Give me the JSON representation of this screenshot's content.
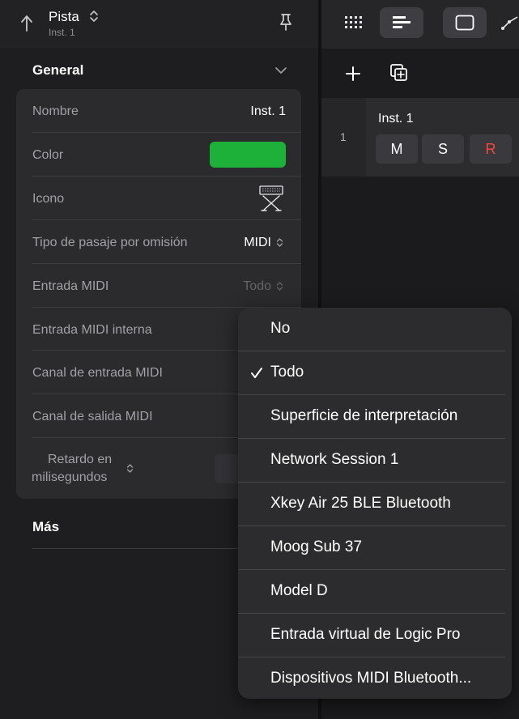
{
  "inspector": {
    "header": {
      "title": "Pista",
      "subtitle": "Inst. 1"
    },
    "general": {
      "title": "General",
      "rows": [
        {
          "label": "Nombre",
          "value": "Inst. 1"
        },
        {
          "label": "Color",
          "value": "",
          "color": "#1eb13a"
        },
        {
          "label": "Icono",
          "icon": "keyboard-stand-icon"
        },
        {
          "label": "Tipo de pasaje por omisión",
          "value": "MIDI"
        },
        {
          "label": "Entrada MIDI",
          "value": "Todo"
        },
        {
          "label": "Entrada MIDI interna"
        },
        {
          "label": "Canal de entrada MIDI"
        },
        {
          "label": "Canal de salida MIDI"
        },
        {
          "label_line1": "Retardo en",
          "label_line2": "milisegundos"
        }
      ]
    },
    "more": {
      "title": "Más"
    }
  },
  "tracks": {
    "rows": [
      {
        "number": "1",
        "name": "Inst. 1",
        "mute": "M",
        "solo": "S",
        "record": "R"
      }
    ]
  },
  "menu": {
    "items": [
      {
        "label": "No",
        "checked": false
      },
      {
        "label": "Todo",
        "checked": true
      },
      {
        "label": "Superficie de interpretación",
        "checked": false
      },
      {
        "label": "Network Session 1",
        "checked": false
      },
      {
        "label": "Xkey Air 25 BLE Bluetooth",
        "checked": false
      },
      {
        "label": "Moog Sub 37",
        "checked": false
      },
      {
        "label": "Model D",
        "checked": false
      },
      {
        "label": "Entrada virtual de Logic Pro",
        "checked": false
      },
      {
        "label": "Dispositivos MIDI Bluetooth...",
        "checked": false
      }
    ]
  },
  "colors": {
    "accent_green": "#1eb13a",
    "record_red": "#ff453a",
    "background": "#1e1e20"
  }
}
